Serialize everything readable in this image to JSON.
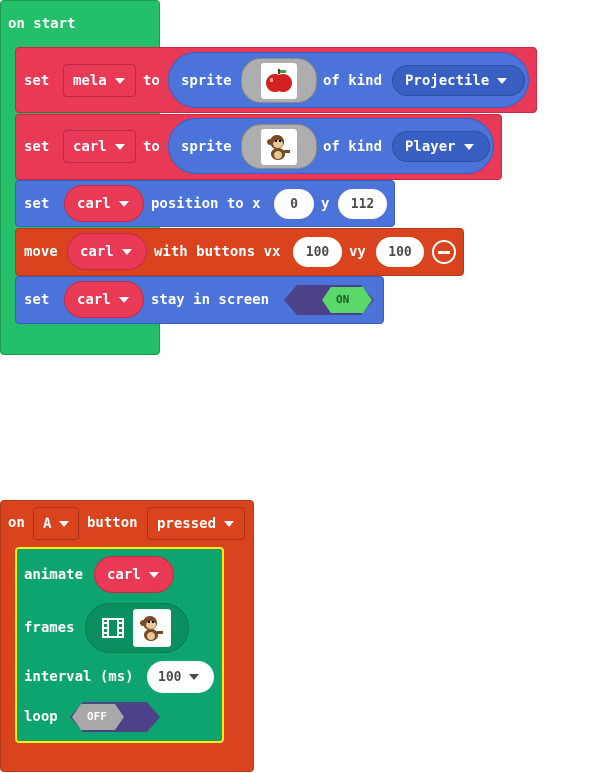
{
  "colors": {
    "loops_green": "#24bf6a",
    "sprite_red": "#e83a57",
    "sprite_blue": "#4b73d9",
    "controller_orange": "#d9441e",
    "animation_green": "#0ea470",
    "selection_yellow": "#ffee00",
    "toggle_on": "#5ad86a",
    "toggle_off": "#a8a8a8",
    "toggle_track": "#4d4289"
  },
  "on_start": {
    "header": "on start",
    "blocks": [
      {
        "set": "set",
        "variable": "mela",
        "to": "to",
        "sprite": "sprite",
        "image_icon": "apple-sprite-icon",
        "of_kind": "of kind",
        "kind": "Projectile"
      },
      {
        "set": "set",
        "variable": "carl",
        "to": "to",
        "sprite": "sprite",
        "image_icon": "monkey-sprite-icon",
        "of_kind": "of kind",
        "kind": "Player"
      },
      {
        "set": "set",
        "variable": "carl",
        "position_to_x": "position to x",
        "x": "0",
        "y_label": "y",
        "y": "112"
      },
      {
        "move": "move",
        "variable": "carl",
        "with_buttons_vx": "with buttons vx",
        "vx": "100",
        "vy_label": "vy",
        "vy": "100",
        "remove_icon": "minus-circle-icon"
      },
      {
        "set": "set",
        "variable": "carl",
        "stay_in_screen": "stay in screen",
        "toggle": "ON"
      }
    ]
  },
  "on_button": {
    "on": "on",
    "button": "A",
    "button_label": "button",
    "event": "pressed",
    "animate_block": {
      "animate": "animate",
      "variable": "carl",
      "frames": "frames",
      "frames_icon": "film-strip-icon",
      "frame_icon": "monkey-sprite-icon",
      "interval": "interval (ms)",
      "interval_value": "100",
      "loop": "loop",
      "loop_toggle": "OFF"
    }
  }
}
